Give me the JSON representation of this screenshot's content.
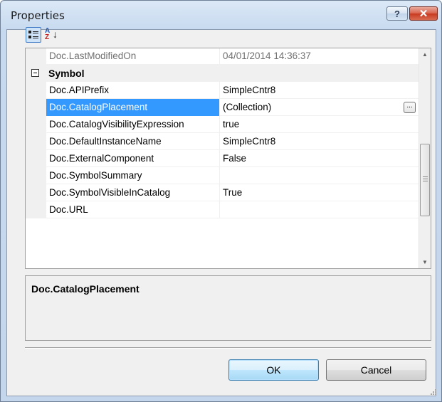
{
  "window": {
    "title": "Properties",
    "help_label": "?",
    "close_label": "✕"
  },
  "toolbar": {
    "alpha_top": "A",
    "alpha_bottom": "Z",
    "alpha_arrow": "↓"
  },
  "grid": {
    "rows": [
      {
        "kind": "property",
        "name": "Doc.LastModifiedOn",
        "value": "04/01/2014 14:36:37",
        "readonly": true
      },
      {
        "kind": "category",
        "name": "Symbol"
      },
      {
        "kind": "property",
        "name": "Doc.APIPrefix",
        "value": "SimpleCntr8"
      },
      {
        "kind": "property",
        "name": "Doc.CatalogPlacement",
        "value": "(Collection)",
        "selected": true
      },
      {
        "kind": "property",
        "name": "Doc.CatalogVisibilityExpression",
        "value": "true"
      },
      {
        "kind": "property",
        "name": "Doc.DefaultInstanceName",
        "value": "SimpleCntr8"
      },
      {
        "kind": "property",
        "name": "Doc.ExternalComponent",
        "value": "False"
      },
      {
        "kind": "property",
        "name": "Doc.SymbolSummary",
        "value": ""
      },
      {
        "kind": "property",
        "name": "Doc.SymbolVisibleInCatalog",
        "value": "True"
      },
      {
        "kind": "property",
        "name": "Doc.URL",
        "value": ""
      }
    ],
    "ellipsis_label": "...",
    "scroll_up": "▲",
    "scroll_down": "▼"
  },
  "description": {
    "title": "Doc.CatalogPlacement"
  },
  "buttons": {
    "ok": "OK",
    "cancel": "Cancel"
  },
  "colors": {
    "selection": "#3399ff",
    "accent_border": "#3c7fb1",
    "close_red": "#c8391f"
  }
}
